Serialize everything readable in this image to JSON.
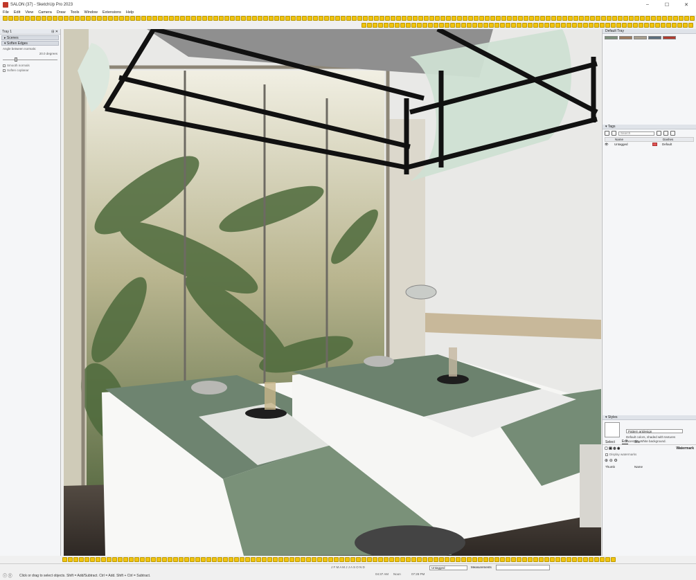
{
  "window": {
    "title": "SALON (37) - SketchUp Pro 2023",
    "controls": [
      "–",
      "☐",
      "✕"
    ]
  },
  "menu": [
    "File",
    "Edit",
    "View",
    "Camera",
    "Draw",
    "Tools",
    "Window",
    "Extensions",
    "Help"
  ],
  "tray_left": {
    "title": "Tray 1",
    "sections": [
      "Scenes",
      "Soften Edges"
    ],
    "angle_label": "Angle between normals:",
    "angle_value": "20.0  degrees",
    "angle_fraction": 0.22,
    "options": [
      "Smooth normals",
      "Soften coplanar"
    ]
  },
  "tray_right": {
    "title": "Default Tray",
    "swatch_colors": [
      "#7a8e7a",
      "#9c7a5e",
      "#a69c8c",
      "#5b6d7d",
      "#b03a2e"
    ],
    "tags": {
      "header": "Tags",
      "search_placeholder": "Search",
      "columns": [
        "Name",
        "Dashes"
      ],
      "rows": [
        {
          "name": "Untagged",
          "color": "#e05555",
          "dashes": "Default"
        }
      ]
    },
    "styles": {
      "header": "Styles",
      "name": "Pattern artdesign",
      "description": "Default colors, shaded with textures facestyle. White background.",
      "tabs": [
        "Select",
        "Edit",
        "Mix"
      ],
      "watermark_label": "Watermark",
      "display_watermarks": "Display watermarks",
      "columns": [
        "Thumb",
        "Name"
      ]
    }
  },
  "status": {
    "message": "Click or drag to select objects. Shift = Add/Subtract. Ctrl = Add. Shift + Ctrl = Subtract.",
    "months": "J F M A M J J A S O N D",
    "time_left": "04:37 AM",
    "time_mid": "Noon",
    "time_right": "07:28 PM",
    "tag": "Untagged",
    "measurements_label": "Measurements"
  }
}
